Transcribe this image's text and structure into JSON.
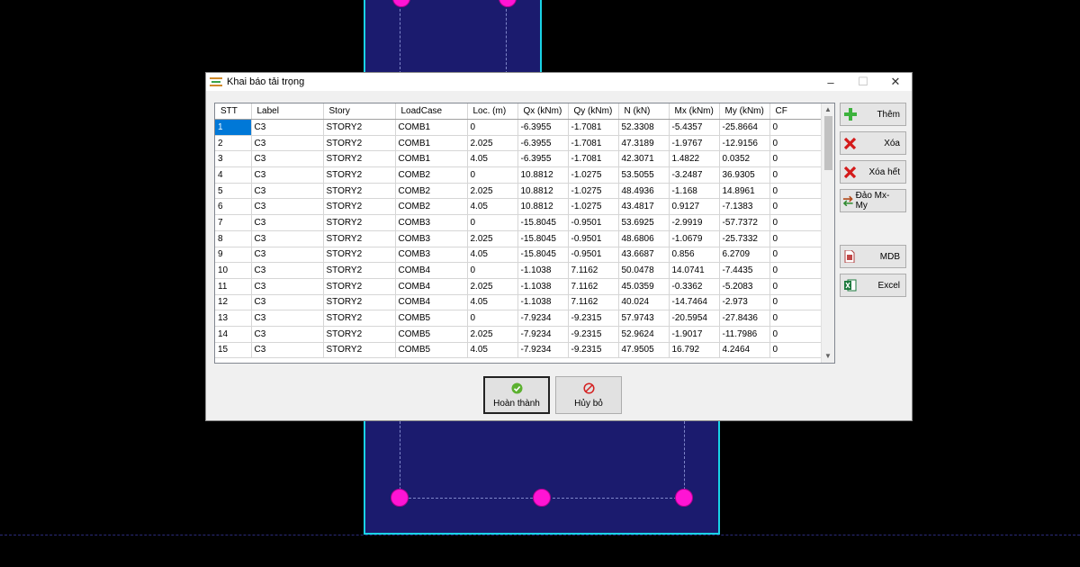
{
  "dialog": {
    "title": "Khai báo tải trọng",
    "minimize": "–",
    "maximize": "☐",
    "close": "✕"
  },
  "grid": {
    "columns": [
      "STT",
      "Label",
      "Story",
      "LoadCase",
      "Loc. (m)",
      "Qx (kNm)",
      "Qy (kNm)",
      "N (kN)",
      "Mx (kNm)",
      "My (kNm)",
      "CF"
    ],
    "rows": [
      [
        "1",
        "C3",
        "STORY2",
        "COMB1",
        "0",
        "-6.3955",
        "-1.7081",
        "52.3308",
        "-5.4357",
        "-25.8664",
        "0"
      ],
      [
        "2",
        "C3",
        "STORY2",
        "COMB1",
        "2.025",
        "-6.3955",
        "-1.7081",
        "47.3189",
        "-1.9767",
        "-12.9156",
        "0"
      ],
      [
        "3",
        "C3",
        "STORY2",
        "COMB1",
        "4.05",
        "-6.3955",
        "-1.7081",
        "42.3071",
        "1.4822",
        "0.0352",
        "0"
      ],
      [
        "4",
        "C3",
        "STORY2",
        "COMB2",
        "0",
        "10.8812",
        "-1.0275",
        "53.5055",
        "-3.2487",
        "36.9305",
        "0"
      ],
      [
        "5",
        "C3",
        "STORY2",
        "COMB2",
        "2.025",
        "10.8812",
        "-1.0275",
        "48.4936",
        "-1.168",
        "14.8961",
        "0"
      ],
      [
        "6",
        "C3",
        "STORY2",
        "COMB2",
        "4.05",
        "10.8812",
        "-1.0275",
        "43.4817",
        "0.9127",
        "-7.1383",
        "0"
      ],
      [
        "7",
        "C3",
        "STORY2",
        "COMB3",
        "0",
        "-15.8045",
        "-0.9501",
        "53.6925",
        "-2.9919",
        "-57.7372",
        "0"
      ],
      [
        "8",
        "C3",
        "STORY2",
        "COMB3",
        "2.025",
        "-15.8045",
        "-0.9501",
        "48.6806",
        "-1.0679",
        "-25.7332",
        "0"
      ],
      [
        "9",
        "C3",
        "STORY2",
        "COMB3",
        "4.05",
        "-15.8045",
        "-0.9501",
        "43.6687",
        "0.856",
        "6.2709",
        "0"
      ],
      [
        "10",
        "C3",
        "STORY2",
        "COMB4",
        "0",
        "-1.1038",
        "7.1162",
        "50.0478",
        "14.0741",
        "-7.4435",
        "0"
      ],
      [
        "11",
        "C3",
        "STORY2",
        "COMB4",
        "2.025",
        "-1.1038",
        "7.1162",
        "45.0359",
        "-0.3362",
        "-5.2083",
        "0"
      ],
      [
        "12",
        "C3",
        "STORY2",
        "COMB4",
        "4.05",
        "-1.1038",
        "7.1162",
        "40.024",
        "-14.7464",
        "-2.973",
        "0"
      ],
      [
        "13",
        "C3",
        "STORY2",
        "COMB5",
        "0",
        "-7.9234",
        "-9.2315",
        "57.9743",
        "-20.5954",
        "-27.8436",
        "0"
      ],
      [
        "14",
        "C3",
        "STORY2",
        "COMB5",
        "2.025",
        "-7.9234",
        "-9.2315",
        "52.9624",
        "-1.9017",
        "-11.7986",
        "0"
      ],
      [
        "15",
        "C3",
        "STORY2",
        "COMB5",
        "4.05",
        "-7.9234",
        "-9.2315",
        "47.9505",
        "16.792",
        "4.2464",
        "0"
      ]
    ]
  },
  "side_buttons": {
    "add": "Thêm",
    "delete": "Xóa",
    "delete_all": "Xóa hết",
    "swap": "Đảo Mx-My",
    "mdb": "MDB",
    "excel": "Excel"
  },
  "bottom_buttons": {
    "ok": "Hoàn thành",
    "cancel": "Hủy bỏ"
  },
  "colors": {
    "selection": "#0078d7",
    "cad_section": "#1b1b6e",
    "cad_outline": "#19d3e6",
    "rebar": "#ff14d4"
  }
}
